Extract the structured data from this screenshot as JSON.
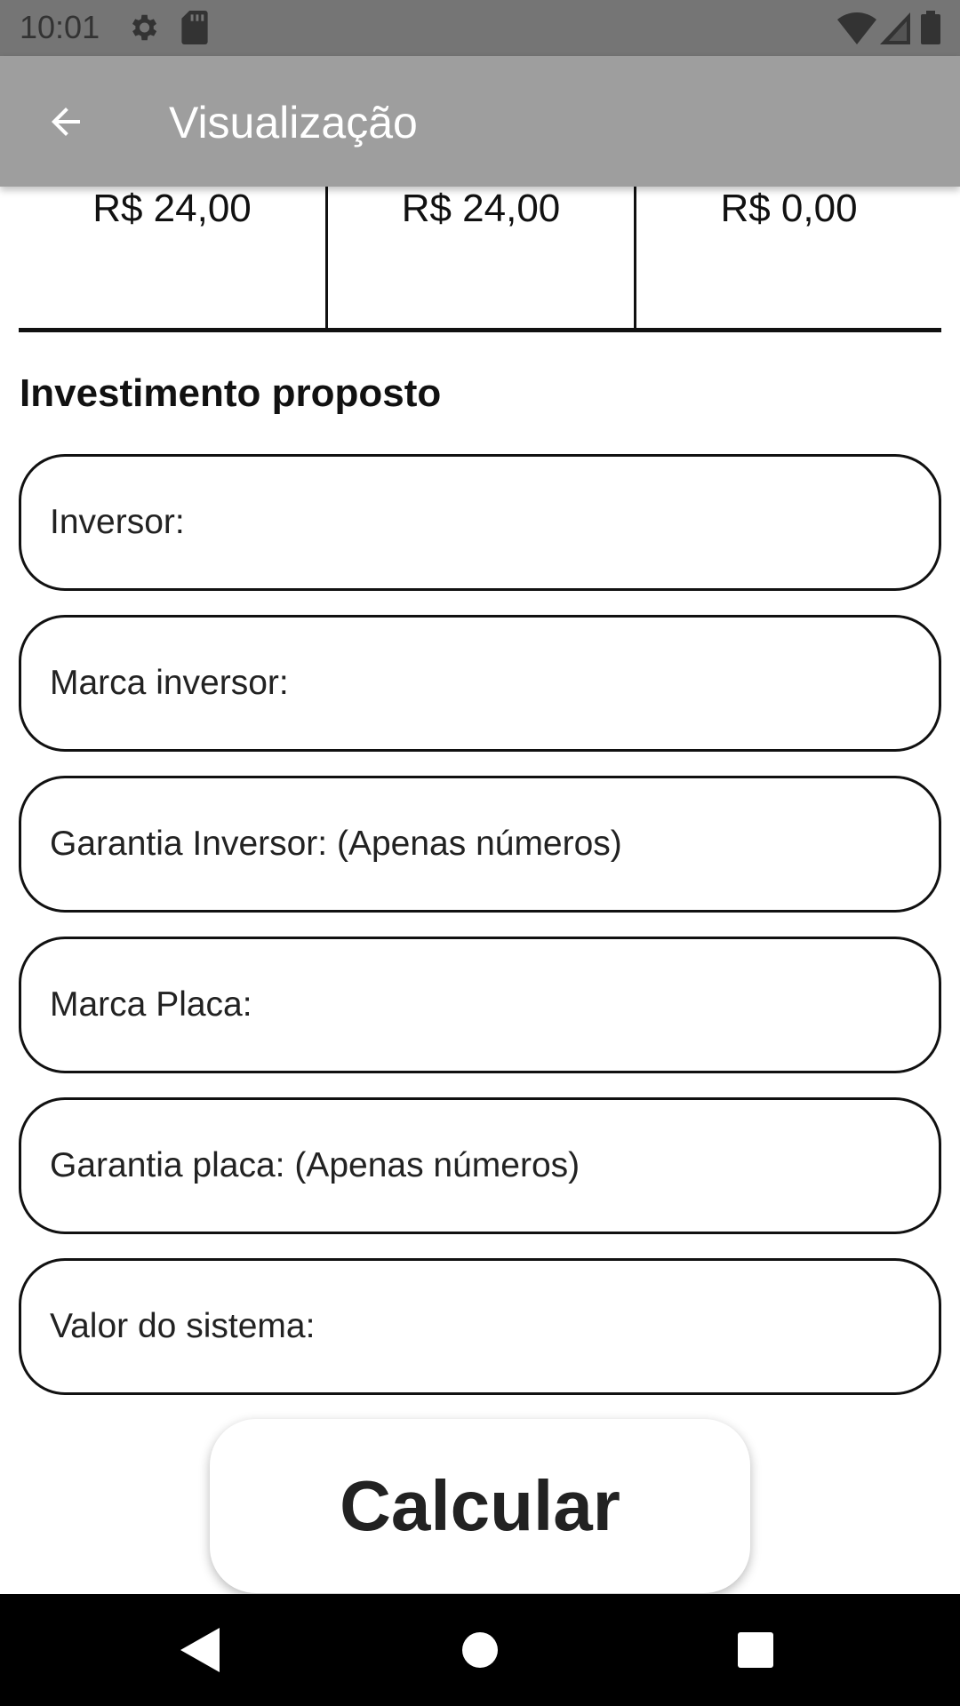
{
  "status_bar": {
    "time": "10:01",
    "left_icons": [
      "gear-icon",
      "sd-card-icon"
    ],
    "right_icons": [
      "wifi-icon",
      "signal-icon",
      "battery-icon"
    ]
  },
  "app_bar": {
    "title": "Visualização",
    "back_icon": "arrow-left-icon"
  },
  "summary_values": [
    "R$ 24,00",
    "R$ 24,00",
    "R$ 0,00"
  ],
  "section": {
    "title": "Investimento proposto"
  },
  "fields": [
    {
      "placeholder": "Inversor:",
      "value": ""
    },
    {
      "placeholder": "Marca inversor:",
      "value": ""
    },
    {
      "placeholder": "Garantia Inversor: (Apenas números)",
      "value": ""
    },
    {
      "placeholder": "Marca Placa:",
      "value": ""
    },
    {
      "placeholder": "Garantia placa: (Apenas números)",
      "value": ""
    },
    {
      "placeholder": "Valor do sistema:",
      "value": ""
    }
  ],
  "calculate_button": {
    "label": "Calcular"
  },
  "nav_bar": {
    "icons": [
      "back-triangle-icon",
      "home-circle-icon",
      "recents-square-icon"
    ]
  },
  "colors": {
    "status_bar": "#757575",
    "app_bar": "#9e9e9e",
    "nav_bar": "#000000"
  }
}
